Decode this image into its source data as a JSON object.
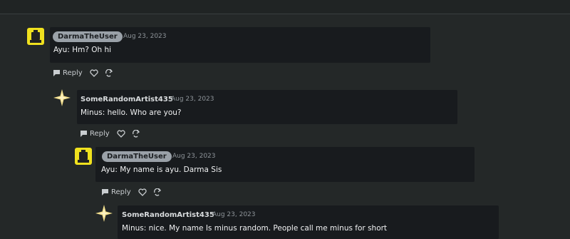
{
  "comments": [
    {
      "author": "DarmaTheUser",
      "author_style": "pill",
      "date": "Aug 23, 2023",
      "text": "Ayu: Hm? Oh hi",
      "reply_label": "Reply",
      "avatar": "pixel-block-avatar"
    },
    {
      "author": "SomeRandomArtist435",
      "author_style": "plain",
      "date": "Aug 23, 2023",
      "text": "Minus: hello. Who are you?",
      "reply_label": "Reply",
      "avatar": "sparkle-star-avatar"
    },
    {
      "author": "DarmaTheUser",
      "author_style": "pill",
      "date": "Aug 23, 2023",
      "text": "Ayu: My name is ayu. Darma Sis",
      "reply_label": "Reply",
      "avatar": "pixel-block-avatar"
    },
    {
      "author": "SomeRandomArtist435",
      "author_style": "plain",
      "date": "Aug 23, 2023",
      "text": "Minus: nice. My name Is minus random. People call me minus for short",
      "avatar": "sparkle-star-avatar"
    }
  ],
  "icons": {
    "reply": "speech-bubble-icon",
    "like": "heart-icon",
    "share": "share-arrow-icon"
  },
  "colors": {
    "background": "#242828",
    "bubble": "#181b1e",
    "name_pill": "#9aa1a8",
    "avatar_yellow": "#f0e11e",
    "star": "#f3df8c"
  }
}
